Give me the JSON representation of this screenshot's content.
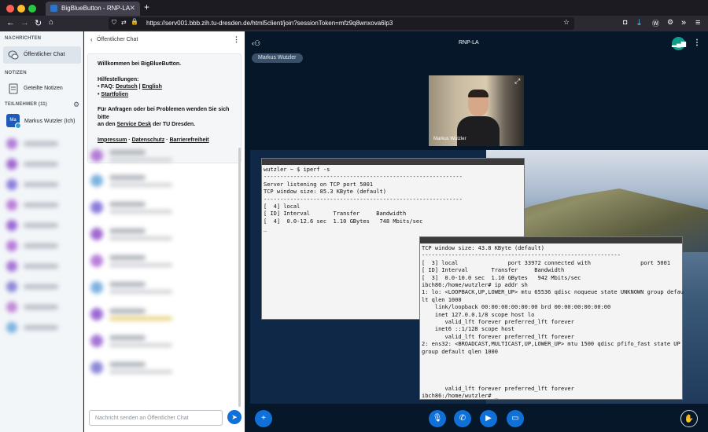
{
  "browser": {
    "tab_title": "BigBlueButton - RNP-LA",
    "url": "https://serv001.bbb.zih.tu-dresden.de/html5client/join?sessionToken=mfz9q8wnxova6lp3",
    "new_tab": "+",
    "close": "✕"
  },
  "sidebar": {
    "messages_title": "NACHRICHTEN",
    "public_chat": "Öffentlicher Chat",
    "notes_title": "NOTIZEN",
    "shared_notes": "Geteilte Notizen",
    "participants_title": "TEILNEHMER (11)",
    "self_name": "Markus Wutzler (Ich)",
    "self_initials": "Ma"
  },
  "chat": {
    "header": "Öffentlicher Chat",
    "welcome_title": "Willkommen bei BigBlueButton.",
    "help_title": "Hilfestellungen:",
    "faq_label": "• FAQ:",
    "faq_de": "Deutsch",
    "faq_sep": "|",
    "faq_en": "English",
    "start_slides": "Startfolien",
    "support_text_1": "Für Anfragen oder bei Problemen wenden Sie sich bitte",
    "support_text_2a": "an den",
    "service_desk": "Service Desk",
    "support_text_2b": "der TU Dresden.",
    "impressum": "Impressum",
    "datenschutz": "Datenschutz",
    "barrierefreiheit": "Barrierefreiheit",
    "input_placeholder": "Nachricht senden an Öffentlicher Chat"
  },
  "meeting": {
    "title": "RNP-LA",
    "presenter_tag": "Markus Wutzler",
    "video_name": "Markus Wutzler"
  },
  "terminal1": {
    "lines": [
      "wutzler ~ $ iperf -s",
      "------------------------------------------------------------",
      "Server listening on TCP port 5001",
      "TCP window size: 85.3 KByte (default)",
      "------------------------------------------------------------",
      "[  4] local",
      "[ ID] Interval       Transfer     Bandwidth",
      "[  4]  0.0-12.6 sec  1.10 GBytes   748 Mbits/sec",
      "_"
    ]
  },
  "terminal2": {
    "lines": [
      "TCP window size: 43.8 KByte (default)",
      "------------------------------------------------------------",
      "[  3] local               port 33972 connected with               port 5001",
      "[ ID] Interval       Transfer     Bandwidth",
      "[  3]  0.0-10.0 sec  1.10 GBytes   942 Mbits/sec",
      "ibch86:/home/wutzler# ip addr sh",
      "1: lo: <LOOPBACK,UP,LOWER_UP> mtu 65536 qdisc noqueue state UNKNOWN group defau",
      "lt qlen 1000",
      "    link/loopback 00:00:00:00:00:00 brd 00:00:00:00:00:00",
      "    inet 127.0.0.1/8 scope host lo",
      "       valid_lft forever preferred_lft forever",
      "    inet6 ::1/128 scope host",
      "       valid_lft forever preferred_lft forever",
      "2: ens32: <BROADCAST,MULTICAST,UP,LOWER_UP> mtu 1500 qdisc pfifo_fast state UP",
      "group default qlen 1000",
      "",
      "",
      "",
      "",
      "       valid_lft forever preferred_lft forever",
      "ibch86:/home/wutzler# _"
    ]
  },
  "colors": {
    "accent": "#0f70d7",
    "main_bg": "#06172a",
    "sidebar_bg": "#f3f6f9"
  }
}
